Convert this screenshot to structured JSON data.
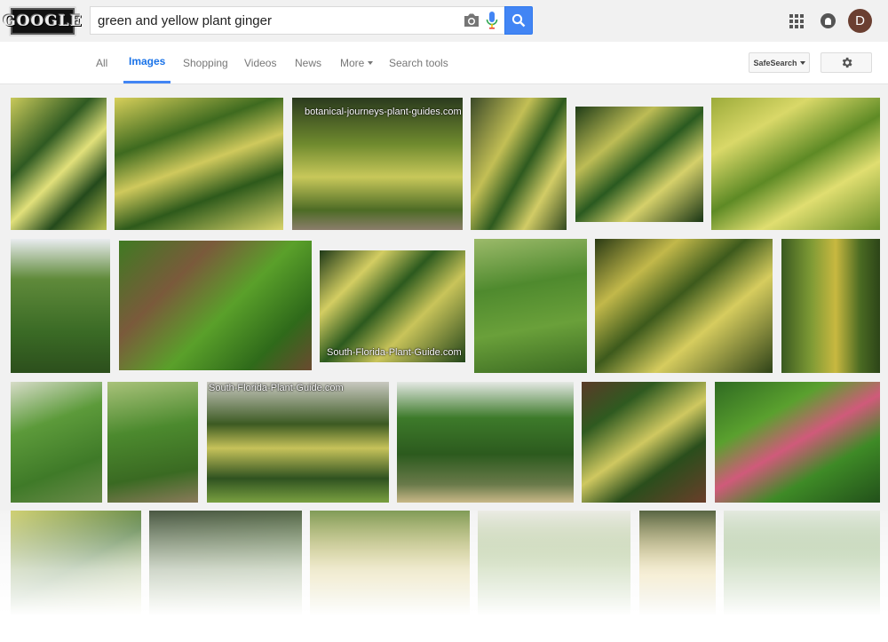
{
  "logo": {
    "text": "GOOGLE"
  },
  "search": {
    "query": "green and yellow plant ginger"
  },
  "nav": {
    "tabs": [
      {
        "label": "All"
      },
      {
        "label": "Images"
      },
      {
        "label": "Shopping"
      },
      {
        "label": "Videos"
      },
      {
        "label": "News"
      },
      {
        "label": "More"
      },
      {
        "label": "Search tools"
      }
    ],
    "safesearch_label": "SafeSearch"
  },
  "user": {
    "avatar_initial": "D"
  },
  "results": {
    "watermarks": {
      "w1": "botanical-journeys-plant-guides.com",
      "w2": "South-Florida-Plant-Guide.com",
      "w3": "South-Florida-Plant-Guide.com"
    }
  },
  "colors": {
    "accent": "#4285f4",
    "active_tab": "#1a73e8",
    "avatar": "#6b3f31"
  },
  "icons": [
    "camera-icon",
    "microphone-icon",
    "search-icon",
    "apps-icon",
    "notifications-icon",
    "gear-icon"
  ]
}
